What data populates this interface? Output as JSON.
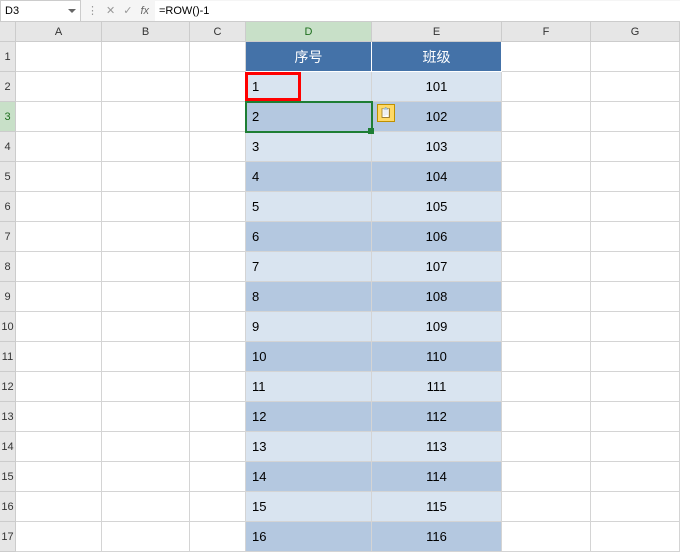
{
  "formula_bar": {
    "cell_ref": "D3",
    "formula": "=ROW()-1"
  },
  "columns": [
    "A",
    "B",
    "C",
    "D",
    "E",
    "F",
    "G"
  ],
  "active_column": "D",
  "active_row": 3,
  "headers": {
    "D": "序号",
    "E": "班级"
  },
  "rows": [
    {
      "n": 1,
      "d": "",
      "e": ""
    },
    {
      "n": 2,
      "d": "1",
      "e": "101"
    },
    {
      "n": 3,
      "d": "2",
      "e": "102"
    },
    {
      "n": 4,
      "d": "3",
      "e": "103"
    },
    {
      "n": 5,
      "d": "4",
      "e": "104"
    },
    {
      "n": 6,
      "d": "5",
      "e": "105"
    },
    {
      "n": 7,
      "d": "6",
      "e": "106"
    },
    {
      "n": 8,
      "d": "7",
      "e": "107"
    },
    {
      "n": 9,
      "d": "8",
      "e": "108"
    },
    {
      "n": 10,
      "d": "9",
      "e": "109"
    },
    {
      "n": 11,
      "d": "10",
      "e": "110"
    },
    {
      "n": 12,
      "d": "11",
      "e": "111"
    },
    {
      "n": 13,
      "d": "12",
      "e": "112"
    },
    {
      "n": 14,
      "d": "13",
      "e": "113"
    },
    {
      "n": 15,
      "d": "14",
      "e": "114"
    },
    {
      "n": 16,
      "d": "15",
      "e": "115"
    },
    {
      "n": 17,
      "d": "16",
      "e": "116"
    }
  ],
  "chart_data": {
    "type": "table",
    "title": "",
    "columns": [
      "序号",
      "班级"
    ],
    "data": [
      [
        1,
        101
      ],
      [
        2,
        102
      ],
      [
        3,
        103
      ],
      [
        4,
        104
      ],
      [
        5,
        105
      ],
      [
        6,
        106
      ],
      [
        7,
        107
      ],
      [
        8,
        108
      ],
      [
        9,
        109
      ],
      [
        10,
        110
      ],
      [
        11,
        111
      ],
      [
        12,
        112
      ],
      [
        13,
        113
      ],
      [
        14,
        114
      ],
      [
        15,
        115
      ],
      [
        16,
        116
      ]
    ]
  }
}
